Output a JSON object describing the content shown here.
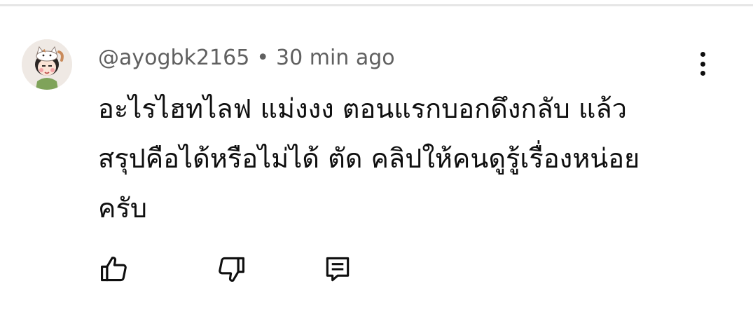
{
  "comment": {
    "author": "@ayogbk2165",
    "separator": "•",
    "timestamp": "30 min ago",
    "text": "อะไรไฮทไลฟ แม่งงง ตอนแรกบอกดึงกลับ แล้ว\nสรุปคือได้หรือไม่ได้ ตัด คลิปให้คนดูรู้เรื่องหน่อย\nครับ"
  },
  "actions": {
    "like_icon": "thumbs-up-icon",
    "dislike_icon": "thumbs-down-icon",
    "reply_icon": "comment-reply-icon",
    "more_icon": "more-vertical-icon"
  },
  "colors": {
    "text_primary": "#0f0f0f",
    "text_secondary": "#606060",
    "background": "#ffffff",
    "divider": "#e6e6e6"
  }
}
